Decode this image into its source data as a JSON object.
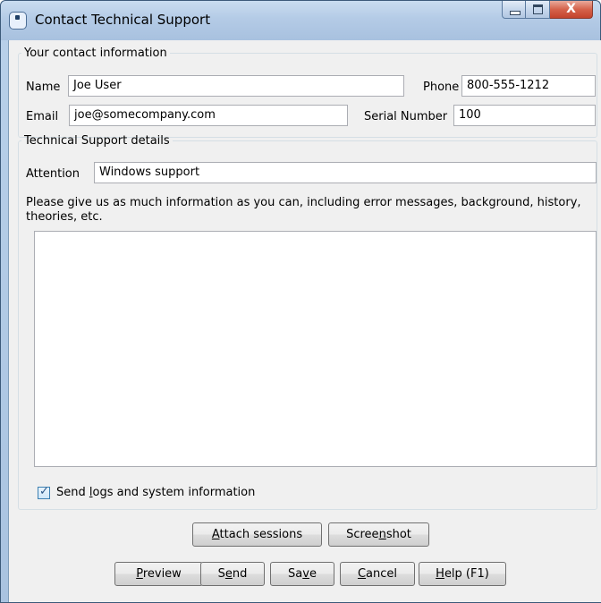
{
  "window": {
    "title": "Contact Technical Support",
    "close_glyph": "X"
  },
  "contact": {
    "legend": "Your contact information",
    "name_label": "Name",
    "name_value": "Joe User",
    "phone_label": "Phone",
    "phone_value": "800-555-1212",
    "email_label": "Email",
    "email_value": "joe@somecompany.com",
    "serial_label": "Serial Number",
    "serial_value": "100"
  },
  "details": {
    "legend": "Technical Support details",
    "attention_label": "Attention",
    "attention_value": "Windows support",
    "instructions": "Please give us as much information as you can, including error messages, background, history, theories, etc.",
    "message_value": ""
  },
  "send_logs": {
    "label_pre": "Send ",
    "label_mnemonic": "l",
    "label_post": "ogs and system information",
    "checked": true
  },
  "buttons": {
    "attach": {
      "pre": "",
      "mn": "A",
      "post": "ttach sessions"
    },
    "screenshot": {
      "pre": "Scree",
      "mn": "n",
      "post": "shot"
    },
    "preview": {
      "pre": "",
      "mn": "P",
      "post": "review"
    },
    "send": {
      "pre": "S",
      "mn": "e",
      "post": "nd"
    },
    "save": {
      "pre": "Sa",
      "mn": "v",
      "post": "e"
    },
    "cancel": {
      "pre": "",
      "mn": "C",
      "post": "ancel"
    },
    "help": {
      "pre": "",
      "mn": "H",
      "post": "elp (F1)"
    }
  },
  "colors": {
    "title_bar": "#b4cbe6",
    "client_bg": "#f0f0f0",
    "close_button": "#c3432c"
  }
}
